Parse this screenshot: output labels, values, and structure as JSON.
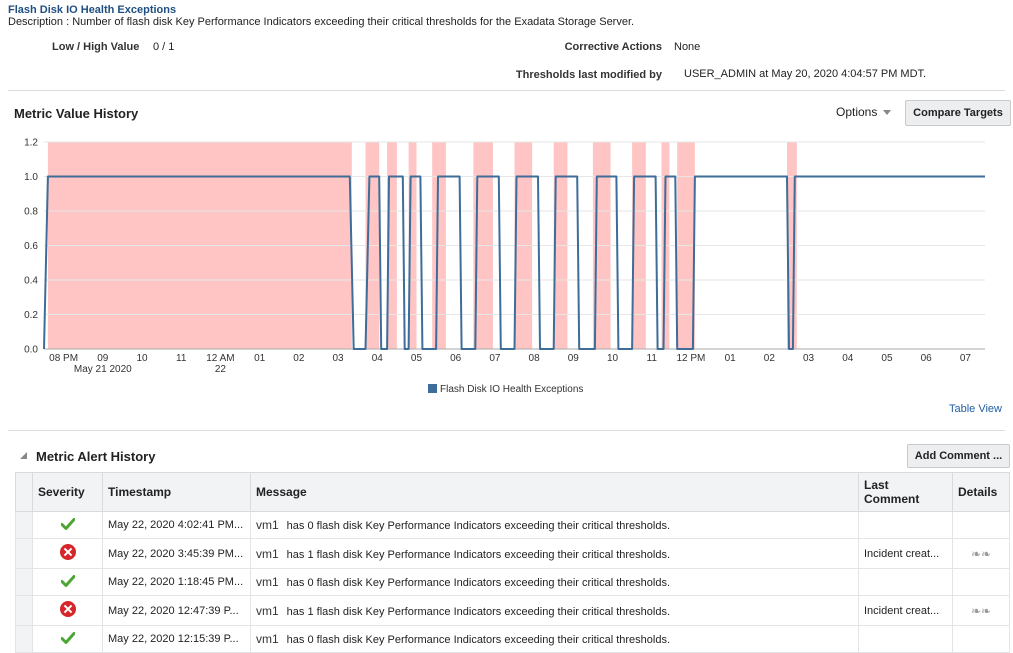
{
  "header": {
    "title": "Flash Disk IO Health Exceptions",
    "description": "Description : Number of flash disk Key Performance Indicators exceeding their critical thresholds for the Exadata Storage Server.",
    "low_high_label": "Low / High Value",
    "low_high_value": "0 / 1",
    "corrective_label": "Corrective Actions",
    "corrective_value": "None",
    "thresholds_label": "Thresholds last modified by",
    "thresholds_value": "USER_ADMIN at May 20, 2020 4:04:57 PM MDT."
  },
  "history": {
    "title": "Metric Value History",
    "options_label": "Options",
    "compare_label": "Compare Targets",
    "table_view_label": "Table View"
  },
  "chart_data": {
    "type": "line",
    "x_tick_labels": [
      "08 PM",
      "09",
      "10",
      "11",
      "12 AM",
      "01",
      "02",
      "03",
      "04",
      "05",
      "06",
      "07",
      "08",
      "09",
      "10",
      "11",
      "12 PM",
      "01",
      "02",
      "03",
      "04",
      "05",
      "06",
      "07"
    ],
    "date_labels": [
      {
        "under": "09",
        "text": "May 21 2020"
      },
      {
        "under": "12 AM",
        "text": "22"
      }
    ],
    "y_ticks": [
      "0.0",
      "0.2",
      "0.4",
      "0.6",
      "0.8",
      "1.0",
      "1.2"
    ],
    "ylim": [
      0,
      1.2
    ],
    "xlim_hours": [
      0,
      24
    ],
    "grid": true,
    "series": [
      {
        "name": "Flash Disk IO Health Exceptions",
        "color": "#3d6d98",
        "x_hours": [
          0,
          0.1,
          7.8,
          7.9,
          8.2,
          8.3,
          8.55,
          8.6,
          8.75,
          8.8,
          9.15,
          9.2,
          9.3,
          9.35,
          9.6,
          9.65,
          10.0,
          10.05,
          10.6,
          10.65,
          11.0,
          11.05,
          11.6,
          11.65,
          12.0,
          12.05,
          12.6,
          12.65,
          13.0,
          13.05,
          13.6,
          13.65,
          14.05,
          14.1,
          14.6,
          14.65,
          15.0,
          15.05,
          15.6,
          15.65,
          15.8,
          15.85,
          16.1,
          16.15,
          16.55,
          16.6,
          18.95,
          19.0,
          19.1,
          19.15,
          24
        ],
        "values": [
          0,
          1,
          1,
          0,
          0,
          1,
          1,
          0,
          0,
          1,
          1,
          0,
          0,
          1,
          1,
          0,
          0,
          1,
          1,
          0,
          0,
          1,
          1,
          0,
          0,
          1,
          1,
          0,
          0,
          1,
          1,
          0,
          0,
          1,
          1,
          0,
          0,
          1,
          1,
          0,
          0,
          1,
          1,
          0,
          0,
          1,
          1,
          0,
          0,
          1,
          1,
          0,
          0,
          1,
          1,
          0
        ]
      }
    ],
    "critical_bands_hours": [
      [
        0.1,
        7.85
      ],
      [
        8.2,
        8.55
      ],
      [
        8.75,
        9.0
      ],
      [
        9.3,
        9.5
      ],
      [
        9.9,
        10.25
      ],
      [
        10.95,
        11.45
      ],
      [
        12.0,
        12.45
      ],
      [
        13.0,
        13.35
      ],
      [
        14.0,
        14.45
      ],
      [
        15.0,
        15.35
      ],
      [
        15.75,
        15.95
      ],
      [
        16.15,
        16.6
      ],
      [
        18.95,
        19.2
      ]
    ],
    "band_color": "#ffc4c4",
    "legend": [
      "Flash Disk IO Health Exceptions"
    ],
    "legend_position": "bottom-center"
  },
  "alerts": {
    "title": "Metric Alert History",
    "add_comment_label": "Add Comment ...",
    "columns": [
      "Severity",
      "Timestamp",
      "Message",
      "Last Comment",
      "Details"
    ],
    "rows": [
      {
        "severity": "ok",
        "timestamp": "May 22, 2020 4:02:41 PM...",
        "host": "vm1",
        "message": "has 0 flash disk Key Performance Indicators exceeding their critical thresholds.",
        "last_comment": "",
        "details": ""
      },
      {
        "severity": "critical",
        "timestamp": "May 22, 2020 3:45:39 PM...",
        "host": "vm1",
        "message": "has 1 flash disk Key Performance Indicators exceeding their critical thresholds.",
        "last_comment": "Incident creat...",
        "details": "glasses-icon"
      },
      {
        "severity": "ok",
        "timestamp": "May 22, 2020 1:18:45 PM...",
        "host": "vm1",
        "message": "has 0 flash disk Key Performance Indicators exceeding their critical thresholds.",
        "last_comment": "",
        "details": ""
      },
      {
        "severity": "critical",
        "timestamp": "May 22, 2020 12:47:39 P...",
        "host": "vm1",
        "message": "has 1 flash disk Key Performance Indicators exceeding their critical thresholds.",
        "last_comment": "Incident creat...",
        "details": "glasses-icon"
      },
      {
        "severity": "ok",
        "timestamp": "May 22, 2020 12:15:39 P...",
        "host": "vm1",
        "message": "has 0 flash disk Key Performance Indicators exceeding their critical thresholds.",
        "last_comment": "",
        "details": ""
      }
    ]
  }
}
